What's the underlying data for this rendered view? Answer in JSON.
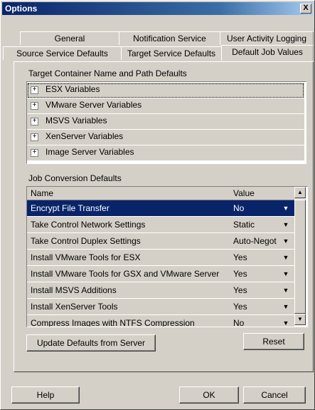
{
  "window": {
    "title": "Options",
    "close_label": "X"
  },
  "tabs": {
    "row1": [
      "General",
      "Notification Service",
      "User Activity Logging"
    ],
    "row2": [
      "Source Service Defaults",
      "Target Service Defaults",
      "Default Job Values"
    ],
    "active": "Default Job Values"
  },
  "target_container": {
    "label": "Target Container Name and Path Defaults",
    "items": [
      "ESX Variables",
      "VMware Server Variables",
      "MSVS Variables",
      "XenServer Variables",
      "Image Server Variables"
    ]
  },
  "job_conversion": {
    "label": "Job Conversion Defaults",
    "headers": {
      "name": "Name",
      "value": "Value"
    },
    "rows": [
      {
        "name": "Encrypt File Transfer",
        "value": "No"
      },
      {
        "name": "Take Control Network Settings",
        "value": "Static"
      },
      {
        "name": "Take Control Duplex Settings",
        "value": "Auto-Negot"
      },
      {
        "name": "Install VMware Tools for ESX",
        "value": "Yes"
      },
      {
        "name": "Install VMware Tools for GSX and VMware Server",
        "value": "Yes"
      },
      {
        "name": "Install MSVS Additions",
        "value": "Yes"
      },
      {
        "name": "Install XenServer Tools",
        "value": "Yes"
      },
      {
        "name": "Compress Images with NTFS Compression",
        "value": "No"
      }
    ]
  },
  "buttons": {
    "update": "Update Defaults from Server",
    "reset": "Reset",
    "help": "Help",
    "ok": "OK",
    "cancel": "Cancel"
  },
  "colors": {
    "titlebar": "#0a246a",
    "selection": "#0a246a",
    "face": "#d4d0c8"
  }
}
